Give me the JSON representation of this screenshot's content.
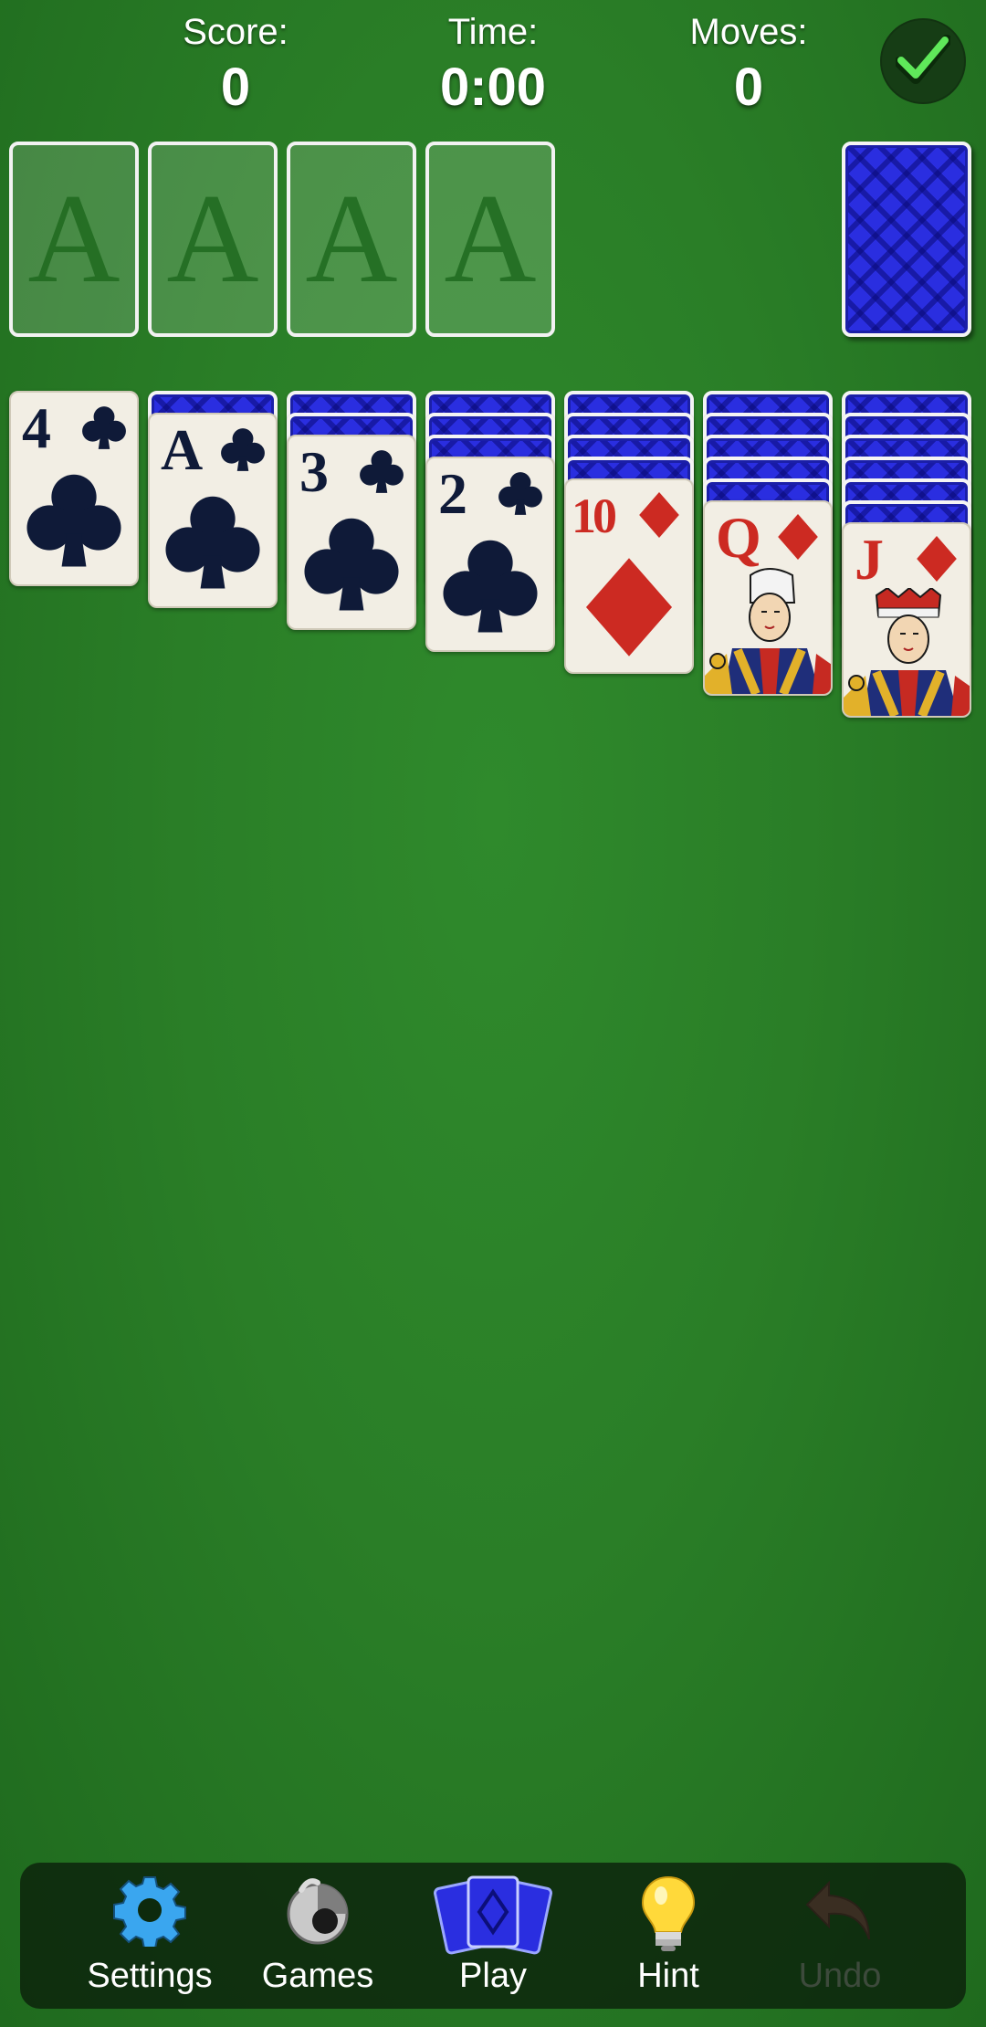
{
  "stats": {
    "score": {
      "label": "Score:",
      "value": "0"
    },
    "time": {
      "label": "Time:",
      "value": "0:00"
    },
    "moves": {
      "label": "Moves:",
      "value": "0"
    }
  },
  "icons": {
    "auto_complete": "checkmark-icon",
    "settings": "gear-icon",
    "games": "games-icon",
    "play": "cards-icon",
    "hint": "lightbulb-icon",
    "undo": "undo-arrow-icon"
  },
  "foundations": [
    "A",
    "A",
    "A",
    "A"
  ],
  "tableau": [
    {
      "face_down": 0,
      "rank": "4",
      "suit": "clubs",
      "color": "black"
    },
    {
      "face_down": 1,
      "rank": "A",
      "suit": "clubs",
      "color": "black"
    },
    {
      "face_down": 2,
      "rank": "3",
      "suit": "clubs",
      "color": "black"
    },
    {
      "face_down": 3,
      "rank": "2",
      "suit": "clubs",
      "color": "black"
    },
    {
      "face_down": 4,
      "rank": "10",
      "suit": "diamonds",
      "color": "red"
    },
    {
      "face_down": 5,
      "rank": "Q",
      "suit": "diamonds",
      "color": "red"
    },
    {
      "face_down": 6,
      "rank": "J",
      "suit": "diamonds",
      "color": "red"
    }
  ],
  "nav": {
    "settings": "Settings",
    "games": "Games",
    "play": "Play",
    "hint": "Hint",
    "undo": "Undo"
  },
  "colors": {
    "felt": "#2a7e27",
    "card_back": "#2a2ee0",
    "black_suit": "#0f1a38",
    "red_suit": "#cc2a22",
    "accent_blue": "#3aa6ef",
    "check_green": "#5fe85a"
  }
}
